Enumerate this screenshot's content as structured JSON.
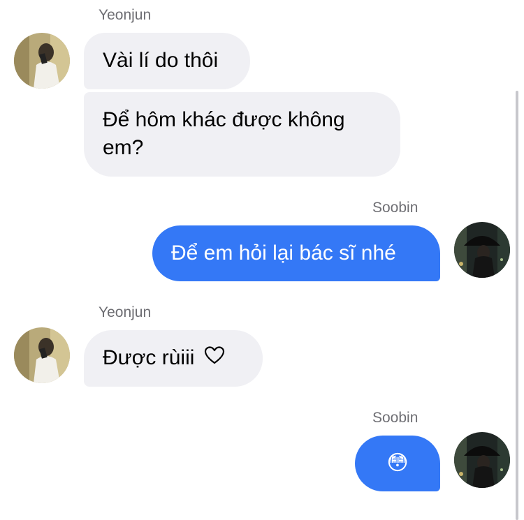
{
  "chat": {
    "messages": [
      {
        "sender": "Yeonjun",
        "text": "Vài lí do thôi"
      },
      {
        "sender": "Yeonjun",
        "text": "Để hôm khác được không em?"
      },
      {
        "sender": "Soobin",
        "text": "Để em hỏi lại bác sĩ nhé"
      },
      {
        "sender": "Yeonjun",
        "text": "Được rùiii",
        "icon": "heart-outline-icon"
      },
      {
        "sender": "Soobin",
        "text": "😳"
      }
    ]
  },
  "colors": {
    "incoming_bubble": "#f0f0f4",
    "outgoing_bubble": "#3478f6",
    "sender_name": "#6e6e73"
  }
}
